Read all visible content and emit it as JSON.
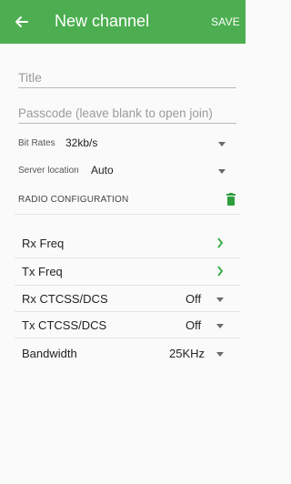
{
  "appbar": {
    "title": "New channel",
    "save_label": "SAVE",
    "back_icon": "arrow-left-icon",
    "color": "#4cae50"
  },
  "form": {
    "title_placeholder": "Title",
    "passcode_placeholder": "Passcode (leave blank to open join)",
    "bit_rates": {
      "label": "Bit Rates",
      "value": "32kb/s"
    },
    "server_location": {
      "label": "Server location",
      "value": "Auto"
    }
  },
  "radio": {
    "section_title": "RADIO CONFIGURATION",
    "delete_icon": "trash-icon",
    "items": [
      {
        "label": "Rx Freq",
        "value": "",
        "control": "chevron"
      },
      {
        "label": "Tx Freq",
        "value": "",
        "control": "chevron"
      },
      {
        "label": "Rx CTCSS/DCS",
        "value": "Off",
        "control": "dropdown"
      },
      {
        "label": "Tx CTCSS/DCS",
        "value": "Off",
        "control": "dropdown"
      },
      {
        "label": "Bandwidth",
        "value": "25KHz",
        "control": "dropdown"
      }
    ]
  }
}
